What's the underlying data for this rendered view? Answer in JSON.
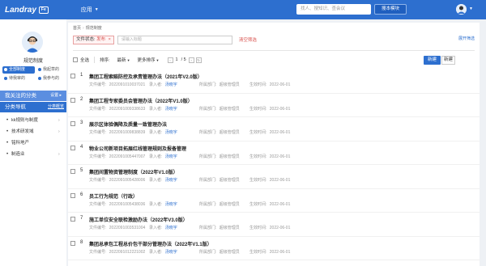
{
  "header": {
    "logo_text": "Landray",
    "logo_badge": "Fe",
    "app_menu_label": "应用",
    "search_placeholder": "找人、搜知识、查会议",
    "search_button": "搜本模块",
    "brand_color": "#2d6fcf"
  },
  "sidebar": {
    "username": "规范制度",
    "tabs": [
      {
        "label": "全部制度"
      },
      {
        "label": "我起草的"
      },
      {
        "label": "待我审的"
      },
      {
        "label": "我参与的"
      }
    ],
    "favorites_title": "我关注的分类",
    "favorites_more": "设置 ▸",
    "category_title": "分类导航",
    "category_more": "分类概览",
    "categories": [
      {
        "label": "kk规则与制度"
      },
      {
        "label": "技术研发域"
      },
      {
        "label": "铭科地产"
      },
      {
        "label": "制造业"
      }
    ]
  },
  "main": {
    "breadcrumb": [
      "首页",
      "规范制度"
    ],
    "expand_filter": "展开筛选",
    "filter_tag_label": "文件状态:",
    "filter_tag_value": "发布",
    "filter_input_placeholder": "请输入标题",
    "clear_filter": "清空筛选",
    "toolbar": {
      "select_all": "全选",
      "sort_label": "排序:",
      "sort_latest": "最新",
      "sort_more": "更多排序",
      "page_current": "1",
      "page_total": "/ 5",
      "new_button": "新建",
      "create_button": "新建"
    },
    "meta_labels": {
      "doc_no": "文件编号:",
      "creator": "录入者:",
      "dept": "所属部门:",
      "effective": "生效时间:"
    },
    "documents": [
      {
        "idx": "1",
        "title": "集团工程索赔防控及承责管理办法（2021年V2.0版）",
        "doc_no": "2022091010037021",
        "creator": "汤晓宇",
        "dept": "超级管理员",
        "effective": "2022-06-01"
      },
      {
        "idx": "2",
        "title": "集团工程专家委员会管理办法（2022年V1.0版）",
        "doc_no": "2022091009338633",
        "creator": "汤晓宇",
        "dept": "超级管理员",
        "effective": "2022-06-01"
      },
      {
        "idx": "3",
        "title": "展示区体验偶降及质量一致管理办法",
        "doc_no": "2022091009838839",
        "creator": "汤晓宇",
        "dept": "超级管理员",
        "effective": "2022-06-01"
      },
      {
        "idx": "4",
        "title": "物业公司新项目拓展红线管理规则及报备管理",
        "doc_no": "2022091005447007",
        "creator": "汤晓宇",
        "dept": "超级管理员",
        "effective": "2022-06-01"
      },
      {
        "idx": "5",
        "title": "集团间置物资管理制度（2022年V1.0版）",
        "doc_no": "2022091005428006",
        "creator": "汤晓宇",
        "dept": "超级管理员",
        "effective": "2022-06-01"
      },
      {
        "idx": "6",
        "title": "员工行为规范（行政）",
        "doc_no": "2022091005438036",
        "creator": "汤晓宇",
        "dept": "超级管理员",
        "effective": "2022-06-01"
      },
      {
        "idx": "7",
        "title": "施工单位安全联检激励办法（2022年V3.0版）",
        "doc_no": "2022091003531004",
        "creator": "汤晓宇",
        "dept": "超级管理员",
        "effective": "2022-06-01"
      },
      {
        "idx": "8",
        "title": "集团总承包工程总价包干部分管理办法（2022年V1.1版）",
        "doc_no": "2022091012221002",
        "creator": "汤晓宇",
        "dept": "超级管理员",
        "effective": "2022-06-01"
      }
    ]
  }
}
